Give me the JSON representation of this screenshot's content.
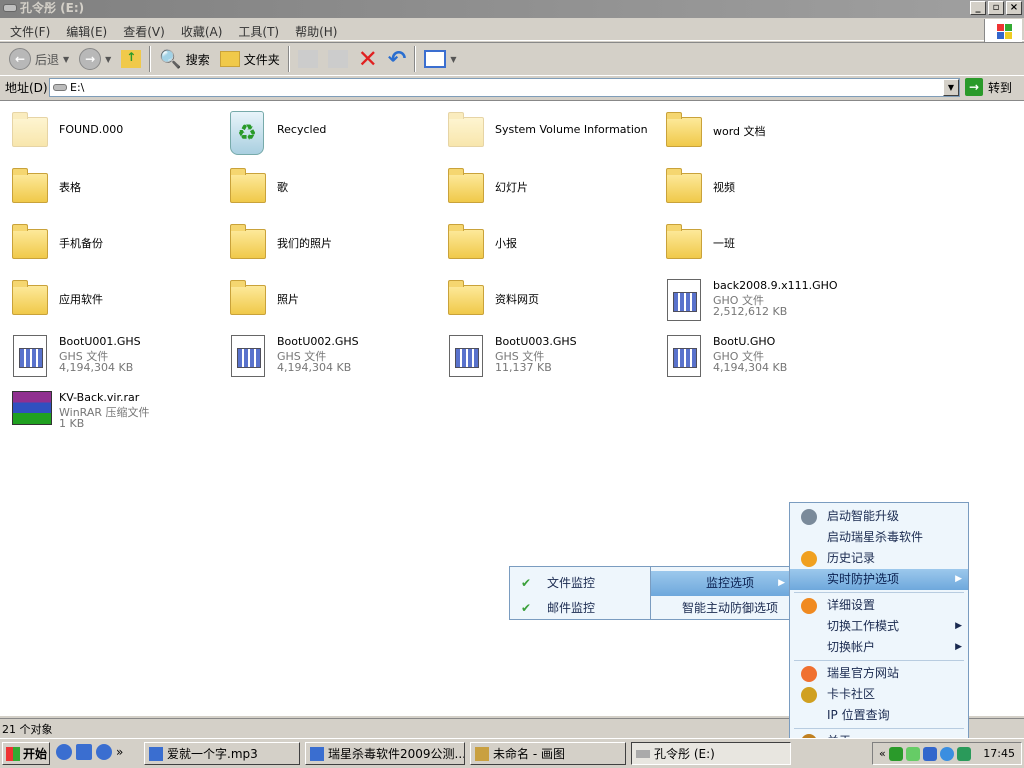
{
  "window": {
    "title": "孔令彤 (E:)",
    "min": "_",
    "max": "▫",
    "close": "×"
  },
  "menubar": [
    "文件(F)",
    "编辑(E)",
    "查看(V)",
    "收藏(A)",
    "工具(T)",
    "帮助(H)"
  ],
  "toolbar": {
    "back": "后退",
    "search": "搜索",
    "folders": "文件夹"
  },
  "address": {
    "label": "地址(D)",
    "value": "E:\\",
    "go": "转到"
  },
  "files": [
    {
      "name": "FOUND.000",
      "type": "folder-faded"
    },
    {
      "name": "Recycled",
      "type": "recycle"
    },
    {
      "name": "System Volume Information",
      "type": "folder-faded"
    },
    {
      "name": "word 文档",
      "type": "folder"
    },
    {
      "name": "表格",
      "type": "folder"
    },
    {
      "name": "歌",
      "type": "folder"
    },
    {
      "name": "幻灯片",
      "type": "folder"
    },
    {
      "name": "视频",
      "type": "folder"
    },
    {
      "name": "手机备份",
      "type": "folder"
    },
    {
      "name": "我们的照片",
      "type": "folder"
    },
    {
      "name": "小报",
      "type": "folder"
    },
    {
      "name": "一班",
      "type": "folder"
    },
    {
      "name": "应用软件",
      "type": "folder"
    },
    {
      "name": "照片",
      "type": "folder"
    },
    {
      "name": "资料网页",
      "type": "folder"
    },
    {
      "name": "back2008.9.x111.GHO",
      "type": "doc",
      "kind": "GHO 文件",
      "size": "2,512,612 KB"
    },
    {
      "name": "BootU001.GHS",
      "type": "doc",
      "kind": "GHS 文件",
      "size": "4,194,304 KB"
    },
    {
      "name": "BootU002.GHS",
      "type": "doc",
      "kind": "GHS 文件",
      "size": "4,194,304 KB"
    },
    {
      "name": "BootU003.GHS",
      "type": "doc",
      "kind": "GHS 文件",
      "size": "11,137 KB"
    },
    {
      "name": "BootU.GHO",
      "type": "doc",
      "kind": "GHO 文件",
      "size": "4,194,304 KB"
    },
    {
      "name": "KV-Back.vir.rar",
      "type": "rar",
      "kind": "WinRAR 压缩文件",
      "size": "1 KB"
    }
  ],
  "status": "21 个对象",
  "menu_main": [
    {
      "label": "启动智能升级",
      "icon": "update-icon",
      "color": "#7a8a9a"
    },
    {
      "label": "启动瑞星杀毒软件"
    },
    {
      "label": "历史记录",
      "icon": "history-icon",
      "color": "#f0a020"
    },
    {
      "label": "实时防护选项",
      "sub": true,
      "hl": true
    },
    {
      "sep": true
    },
    {
      "label": "详细设置",
      "icon": "settings-icon",
      "color": "#f08a20"
    },
    {
      "label": "切换工作模式",
      "sub": true
    },
    {
      "label": "切换帐户",
      "sub": true
    },
    {
      "sep": true
    },
    {
      "label": "瑞星官方网站",
      "icon": "info-icon",
      "color": "#f07030"
    },
    {
      "label": "卡卡社区",
      "icon": "lion-icon",
      "color": "#d0a020"
    },
    {
      "label": "IP 位置查询"
    },
    {
      "sep": true
    },
    {
      "label": "关于",
      "icon": "lion-shield-icon",
      "color": "#c08020"
    }
  ],
  "menu_protect": [
    {
      "label": "监控选项",
      "sub": true,
      "hl": true
    },
    {
      "label": "智能主动防御选项"
    }
  ],
  "menu_monitor": [
    {
      "label": "文件监控",
      "checked": true
    },
    {
      "label": "邮件监控",
      "checked": true
    }
  ],
  "taskbar": {
    "start": "开始",
    "more": "»",
    "tasks": [
      "爱就一个字.mp3",
      "瑞星杀毒软件2009公测...",
      "未命名 - 画图",
      "孔令彤 (E:)"
    ],
    "clock": "17:45",
    "tray_expand": "«"
  }
}
